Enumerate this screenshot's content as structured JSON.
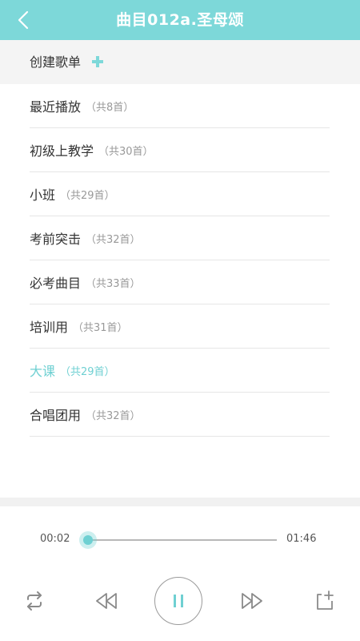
{
  "header": {
    "title": "曲目012a.圣母颂",
    "back_icon": "chevron-left-icon"
  },
  "create": {
    "label": "创建歌单",
    "icon": "plus-icon"
  },
  "playlists": [
    {
      "name": "最近播放",
      "count": "（共8首）",
      "active": false
    },
    {
      "name": "初级上教学",
      "count": "（共30首）",
      "active": false
    },
    {
      "name": "小班",
      "count": "（共29首）",
      "active": false
    },
    {
      "name": "考前突击",
      "count": "（共32首）",
      "active": false
    },
    {
      "name": "必考曲目",
      "count": "（共33首）",
      "active": false
    },
    {
      "name": "培训用",
      "count": "（共31首）",
      "active": false
    },
    {
      "name": "大课",
      "count": "（共29首）",
      "active": true
    },
    {
      "name": "合唱团用",
      "count": "（共32首）",
      "active": false
    }
  ],
  "player": {
    "current_time": "00:02",
    "total_time": "01:46",
    "progress": 0.02,
    "state": "playing",
    "controls": [
      "repeat-icon",
      "previous-icon",
      "pause-icon",
      "next-icon",
      "add-to-playlist-icon"
    ]
  },
  "colors": {
    "accent": "#7dd8d9",
    "active_text": "#6fd0d2",
    "icon_gray": "#8a8a8a"
  }
}
